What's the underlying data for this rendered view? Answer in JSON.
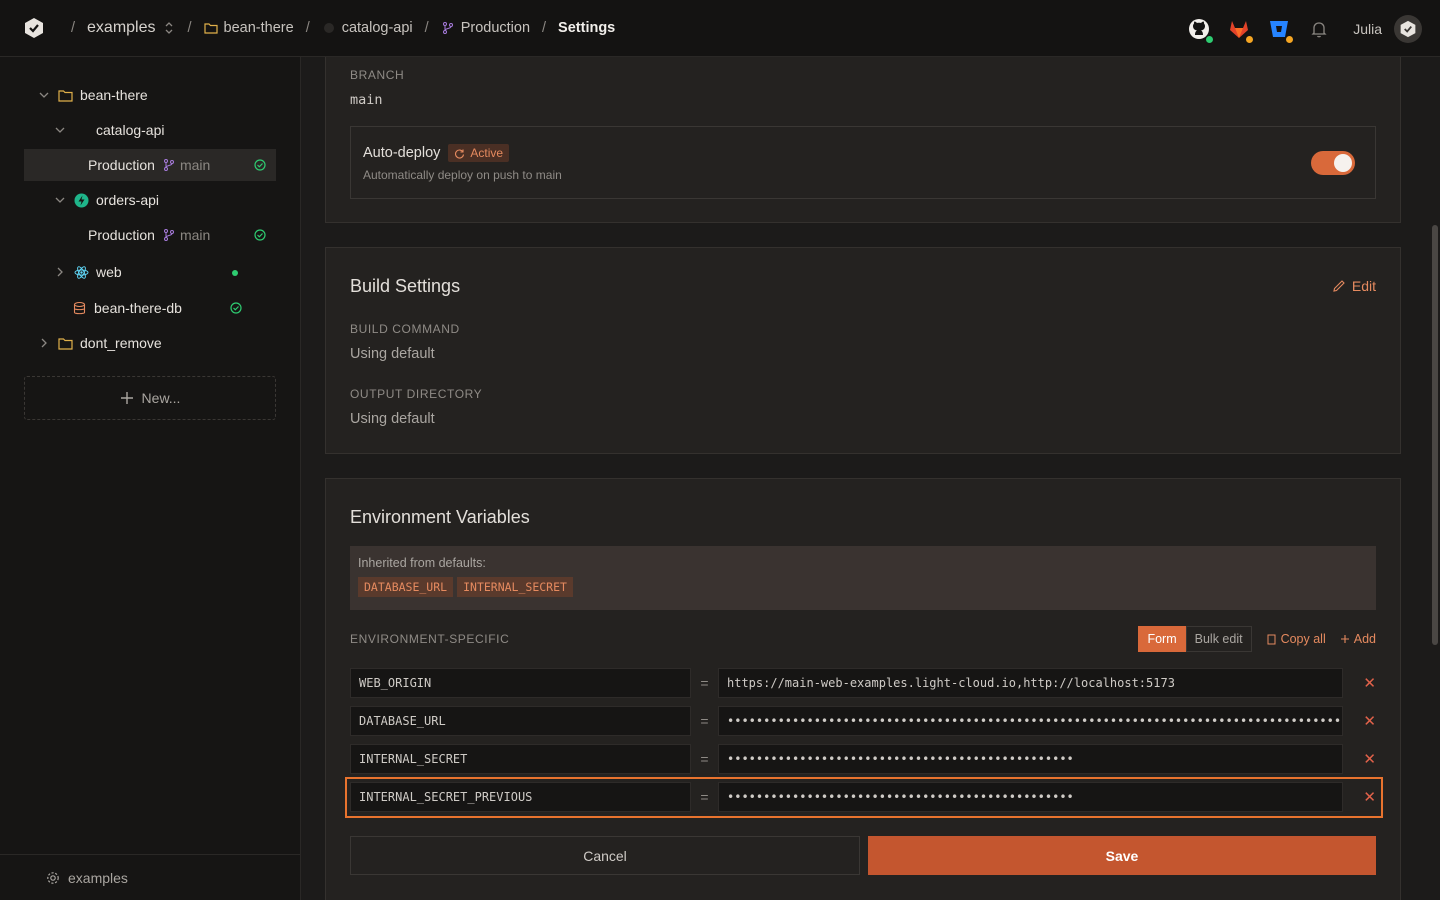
{
  "topbar": {
    "crumbs": {
      "team": "examples",
      "project": "bean-there",
      "service": "catalog-api",
      "environment": "Production",
      "page": "Settings"
    },
    "separator": "/",
    "user": "Julia",
    "tools": [
      "github-icon",
      "gitlab-icon",
      "bitbucket-icon",
      "bell-icon"
    ]
  },
  "sidebar": {
    "project": "bean-there",
    "service1": "catalog-api",
    "env1": "Production",
    "env1_branch": "main",
    "service2": "orders-api",
    "env2": "Production",
    "env2_branch": "main",
    "service3": "web",
    "database": "bean-there-db",
    "project2": "dont_remove",
    "new_label": "New...",
    "footer_label": "examples"
  },
  "branch_card": {
    "branch_label": "BRANCH",
    "branch_value": "main",
    "autodeploy_title": "Auto-deploy",
    "autodeploy_badge": "Active",
    "autodeploy_desc": "Automatically deploy on push to main",
    "autodeploy_on": true
  },
  "build_card": {
    "title": "Build Settings",
    "edit_label": "Edit",
    "build_command_label": "BUILD COMMAND",
    "build_command_value": "Using default",
    "output_dir_label": "OUTPUT DIRECTORY",
    "output_dir_value": "Using default"
  },
  "env_card": {
    "title": "Environment Variables",
    "inherited_label": "Inherited from defaults:",
    "inherited_tags": [
      "DATABASE_URL",
      "INTERNAL_SECRET"
    ],
    "section_label": "ENVIRONMENT-SPECIFIC",
    "mode_form": "Form",
    "mode_bulk": "Bulk edit",
    "copy_all": "Copy all",
    "add": "Add",
    "equals": "=",
    "rows": [
      {
        "key": "WEB_ORIGIN",
        "value": "https://main-web-examples.light-cloud.io,http://localhost:5173"
      },
      {
        "key": "DATABASE_URL",
        "value": "•••••••••••••••••••••••••••••••••••••••••••••••••••••••••••••••••••••••••••••••••••••"
      },
      {
        "key": "INTERNAL_SECRET",
        "value": "••••••••••••••••••••••••••••••••••••••••••••••••"
      },
      {
        "key": "INTERNAL_SECRET_PREVIOUS",
        "value": "••••••••••••••••••••••••••••••••••••••••••••••••"
      }
    ],
    "cancel": "Cancel",
    "save": "Save"
  },
  "colors": {
    "accent": "#d9693a",
    "success": "#2ecc71",
    "danger": "#e2624a"
  }
}
